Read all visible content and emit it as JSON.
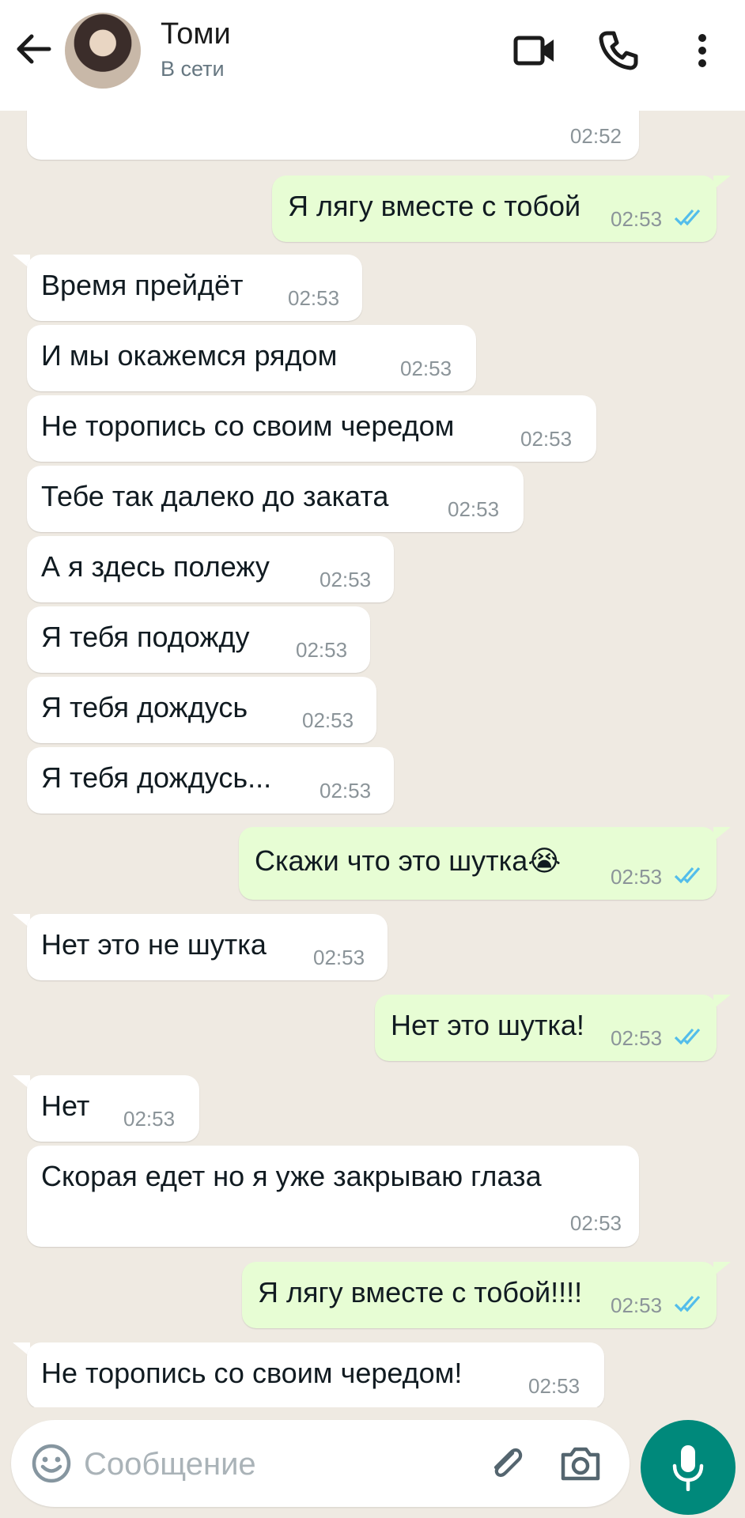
{
  "header": {
    "contact_name": "Томи",
    "status": "В сети"
  },
  "messages": [
    {
      "dir": "in",
      "text": "",
      "time": "02:52"
    },
    {
      "dir": "out",
      "text": "Я лягу вместе с тобой",
      "time": "02:53",
      "read": true
    },
    {
      "dir": "in",
      "text": "Время прейдёт",
      "time": "02:53"
    },
    {
      "dir": "in",
      "text": "И мы окажемся рядом",
      "time": "02:53"
    },
    {
      "dir": "in",
      "text": "Не торопись со своим чередом",
      "time": "02:53"
    },
    {
      "dir": "in",
      "text": "Тебе так далеко до заката",
      "time": "02:53"
    },
    {
      "dir": "in",
      "text": "А я здесь полежу",
      "time": "02:53"
    },
    {
      "dir": "in",
      "text": "Я тебя подожду",
      "time": "02:53"
    },
    {
      "dir": "in",
      "text": "Я тебя дождусь",
      "time": "02:53"
    },
    {
      "dir": "in",
      "text": "Я тебя дождусь...",
      "time": "02:53"
    },
    {
      "dir": "out",
      "text": "Скажи что это шутка😭",
      "time": "02:53",
      "read": true
    },
    {
      "dir": "in",
      "text": "Нет это не шутка",
      "time": "02:53"
    },
    {
      "dir": "out",
      "text": "Нет это шутка!",
      "time": "02:53",
      "read": true
    },
    {
      "dir": "in",
      "text": "Нет",
      "time": "02:53"
    },
    {
      "dir": "in",
      "text": "Скорая едет но я уже закрываю глаза",
      "time": "02:53"
    },
    {
      "dir": "out",
      "text": "Я лягу вместе с тобой!!!!",
      "time": "02:53",
      "read": true
    },
    {
      "dir": "in",
      "text": "Не торопись со своим чередом!",
      "time": "02:53"
    }
  ],
  "input": {
    "placeholder": "Сообщение"
  },
  "colors": {
    "background": "#efeae2",
    "incoming": "#ffffff",
    "outgoing": "#e7fdd4",
    "read_ticks": "#53bdeb",
    "accent": "#00897b"
  }
}
